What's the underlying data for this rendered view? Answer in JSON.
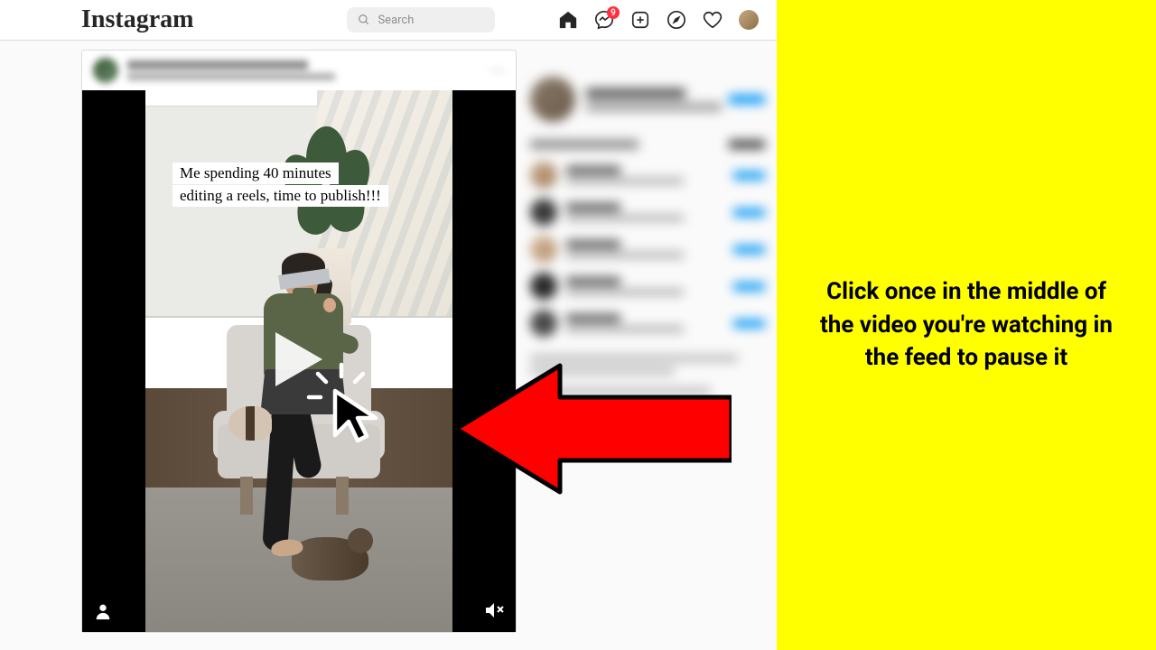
{
  "header": {
    "logo": "Instagram",
    "searchPlaceholder": "Search",
    "messengerBadge": "9"
  },
  "video": {
    "captionLine1": "Me spending 40 minutes",
    "captionLine2": "editing a reels, time to publish!!!"
  },
  "annotation": {
    "text": "Click once in the middle of the video you're watching in the feed to pause it"
  },
  "icons": {
    "home": "home-icon",
    "messenger": "messenger-icon",
    "newpost": "new-post-icon",
    "explore": "explore-icon",
    "activity": "activity-icon"
  }
}
